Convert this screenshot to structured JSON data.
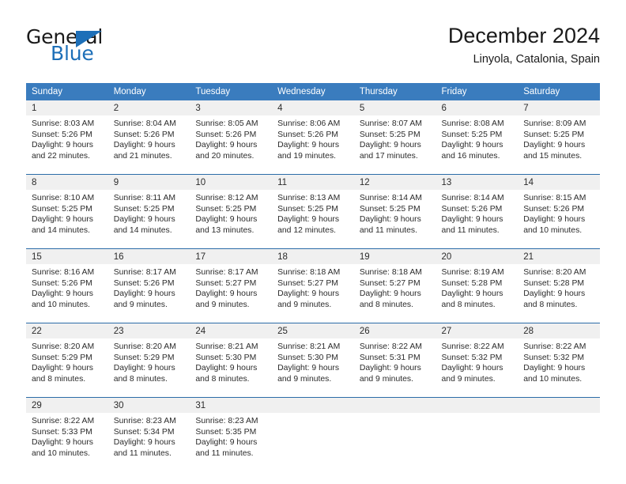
{
  "brand": {
    "name_part1": "General",
    "name_part2": "Blue"
  },
  "header": {
    "title": "December 2024",
    "subtitle": "Linyola, Catalonia, Spain"
  },
  "colors": {
    "header_blue": "#3a7cbe",
    "rule_blue": "#2c6ca8",
    "date_band": "#f0f0f0",
    "brand_blue": "#1d6fb8"
  },
  "weekdays": [
    "Sunday",
    "Monday",
    "Tuesday",
    "Wednesday",
    "Thursday",
    "Friday",
    "Saturday"
  ],
  "weeks": [
    [
      {
        "day": "1",
        "sunrise": "Sunrise: 8:03 AM",
        "sunset": "Sunset: 5:26 PM",
        "daylight1": "Daylight: 9 hours",
        "daylight2": "and 22 minutes."
      },
      {
        "day": "2",
        "sunrise": "Sunrise: 8:04 AM",
        "sunset": "Sunset: 5:26 PM",
        "daylight1": "Daylight: 9 hours",
        "daylight2": "and 21 minutes."
      },
      {
        "day": "3",
        "sunrise": "Sunrise: 8:05 AM",
        "sunset": "Sunset: 5:26 PM",
        "daylight1": "Daylight: 9 hours",
        "daylight2": "and 20 minutes."
      },
      {
        "day": "4",
        "sunrise": "Sunrise: 8:06 AM",
        "sunset": "Sunset: 5:26 PM",
        "daylight1": "Daylight: 9 hours",
        "daylight2": "and 19 minutes."
      },
      {
        "day": "5",
        "sunrise": "Sunrise: 8:07 AM",
        "sunset": "Sunset: 5:25 PM",
        "daylight1": "Daylight: 9 hours",
        "daylight2": "and 17 minutes."
      },
      {
        "day": "6",
        "sunrise": "Sunrise: 8:08 AM",
        "sunset": "Sunset: 5:25 PM",
        "daylight1": "Daylight: 9 hours",
        "daylight2": "and 16 minutes."
      },
      {
        "day": "7",
        "sunrise": "Sunrise: 8:09 AM",
        "sunset": "Sunset: 5:25 PM",
        "daylight1": "Daylight: 9 hours",
        "daylight2": "and 15 minutes."
      }
    ],
    [
      {
        "day": "8",
        "sunrise": "Sunrise: 8:10 AM",
        "sunset": "Sunset: 5:25 PM",
        "daylight1": "Daylight: 9 hours",
        "daylight2": "and 14 minutes."
      },
      {
        "day": "9",
        "sunrise": "Sunrise: 8:11 AM",
        "sunset": "Sunset: 5:25 PM",
        "daylight1": "Daylight: 9 hours",
        "daylight2": "and 14 minutes."
      },
      {
        "day": "10",
        "sunrise": "Sunrise: 8:12 AM",
        "sunset": "Sunset: 5:25 PM",
        "daylight1": "Daylight: 9 hours",
        "daylight2": "and 13 minutes."
      },
      {
        "day": "11",
        "sunrise": "Sunrise: 8:13 AM",
        "sunset": "Sunset: 5:25 PM",
        "daylight1": "Daylight: 9 hours",
        "daylight2": "and 12 minutes."
      },
      {
        "day": "12",
        "sunrise": "Sunrise: 8:14 AM",
        "sunset": "Sunset: 5:25 PM",
        "daylight1": "Daylight: 9 hours",
        "daylight2": "and 11 minutes."
      },
      {
        "day": "13",
        "sunrise": "Sunrise: 8:14 AM",
        "sunset": "Sunset: 5:26 PM",
        "daylight1": "Daylight: 9 hours",
        "daylight2": "and 11 minutes."
      },
      {
        "day": "14",
        "sunrise": "Sunrise: 8:15 AM",
        "sunset": "Sunset: 5:26 PM",
        "daylight1": "Daylight: 9 hours",
        "daylight2": "and 10 minutes."
      }
    ],
    [
      {
        "day": "15",
        "sunrise": "Sunrise: 8:16 AM",
        "sunset": "Sunset: 5:26 PM",
        "daylight1": "Daylight: 9 hours",
        "daylight2": "and 10 minutes."
      },
      {
        "day": "16",
        "sunrise": "Sunrise: 8:17 AM",
        "sunset": "Sunset: 5:26 PM",
        "daylight1": "Daylight: 9 hours",
        "daylight2": "and 9 minutes."
      },
      {
        "day": "17",
        "sunrise": "Sunrise: 8:17 AM",
        "sunset": "Sunset: 5:27 PM",
        "daylight1": "Daylight: 9 hours",
        "daylight2": "and 9 minutes."
      },
      {
        "day": "18",
        "sunrise": "Sunrise: 8:18 AM",
        "sunset": "Sunset: 5:27 PM",
        "daylight1": "Daylight: 9 hours",
        "daylight2": "and 9 minutes."
      },
      {
        "day": "19",
        "sunrise": "Sunrise: 8:18 AM",
        "sunset": "Sunset: 5:27 PM",
        "daylight1": "Daylight: 9 hours",
        "daylight2": "and 8 minutes."
      },
      {
        "day": "20",
        "sunrise": "Sunrise: 8:19 AM",
        "sunset": "Sunset: 5:28 PM",
        "daylight1": "Daylight: 9 hours",
        "daylight2": "and 8 minutes."
      },
      {
        "day": "21",
        "sunrise": "Sunrise: 8:20 AM",
        "sunset": "Sunset: 5:28 PM",
        "daylight1": "Daylight: 9 hours",
        "daylight2": "and 8 minutes."
      }
    ],
    [
      {
        "day": "22",
        "sunrise": "Sunrise: 8:20 AM",
        "sunset": "Sunset: 5:29 PM",
        "daylight1": "Daylight: 9 hours",
        "daylight2": "and 8 minutes."
      },
      {
        "day": "23",
        "sunrise": "Sunrise: 8:20 AM",
        "sunset": "Sunset: 5:29 PM",
        "daylight1": "Daylight: 9 hours",
        "daylight2": "and 8 minutes."
      },
      {
        "day": "24",
        "sunrise": "Sunrise: 8:21 AM",
        "sunset": "Sunset: 5:30 PM",
        "daylight1": "Daylight: 9 hours",
        "daylight2": "and 8 minutes."
      },
      {
        "day": "25",
        "sunrise": "Sunrise: 8:21 AM",
        "sunset": "Sunset: 5:30 PM",
        "daylight1": "Daylight: 9 hours",
        "daylight2": "and 9 minutes."
      },
      {
        "day": "26",
        "sunrise": "Sunrise: 8:22 AM",
        "sunset": "Sunset: 5:31 PM",
        "daylight1": "Daylight: 9 hours",
        "daylight2": "and 9 minutes."
      },
      {
        "day": "27",
        "sunrise": "Sunrise: 8:22 AM",
        "sunset": "Sunset: 5:32 PM",
        "daylight1": "Daylight: 9 hours",
        "daylight2": "and 9 minutes."
      },
      {
        "day": "28",
        "sunrise": "Sunrise: 8:22 AM",
        "sunset": "Sunset: 5:32 PM",
        "daylight1": "Daylight: 9 hours",
        "daylight2": "and 10 minutes."
      }
    ],
    [
      {
        "day": "29",
        "sunrise": "Sunrise: 8:22 AM",
        "sunset": "Sunset: 5:33 PM",
        "daylight1": "Daylight: 9 hours",
        "daylight2": "and 10 minutes."
      },
      {
        "day": "30",
        "sunrise": "Sunrise: 8:23 AM",
        "sunset": "Sunset: 5:34 PM",
        "daylight1": "Daylight: 9 hours",
        "daylight2": "and 11 minutes."
      },
      {
        "day": "31",
        "sunrise": "Sunrise: 8:23 AM",
        "sunset": "Sunset: 5:35 PM",
        "daylight1": "Daylight: 9 hours",
        "daylight2": "and 11 minutes."
      },
      {
        "day": "",
        "sunrise": "",
        "sunset": "",
        "daylight1": "",
        "daylight2": ""
      },
      {
        "day": "",
        "sunrise": "",
        "sunset": "",
        "daylight1": "",
        "daylight2": ""
      },
      {
        "day": "",
        "sunrise": "",
        "sunset": "",
        "daylight1": "",
        "daylight2": ""
      },
      {
        "day": "",
        "sunrise": "",
        "sunset": "",
        "daylight1": "",
        "daylight2": ""
      }
    ]
  ]
}
